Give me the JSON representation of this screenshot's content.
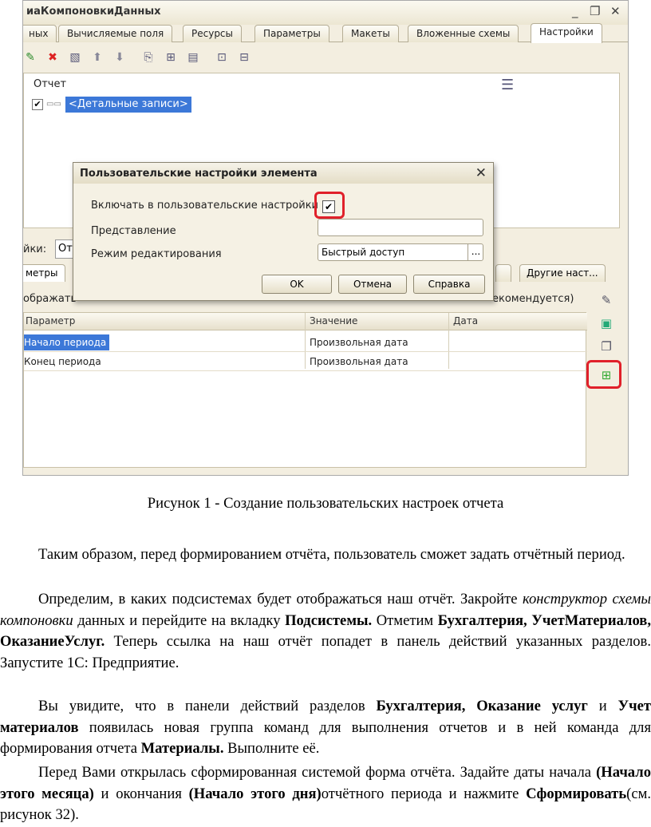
{
  "window": {
    "title": "иаКомпоновкиДанных",
    "min": "_",
    "restore": "❐",
    "close": "✕"
  },
  "tabs": [
    "ных",
    "Вычисляемые поля",
    "Ресурсы",
    "Параметры",
    "Макеты",
    "Вложенные схемы",
    "Настройки"
  ],
  "tree": {
    "root": "Отчет",
    "selected": "<Детальные записи>"
  },
  "lower": {
    "label": "йки:",
    "combo": "От",
    "tab_params": "метры",
    "tab_other": "Другие наст...",
    "display_text": "ображать",
    "recommend_text": "екомендуется)"
  },
  "grid": {
    "headers": [
      "Параметр",
      "Значение",
      "Дата"
    ],
    "rows": [
      {
        "param": "Начало периода",
        "value": "Произвольная дата",
        "date": ""
      },
      {
        "param": "Конец периода",
        "value": "Произвольная дата",
        "date": ""
      }
    ]
  },
  "dialog": {
    "title": "Пользовательские настройки элемента",
    "include_label": "Включать в пользовательские настройки",
    "presentation_label": "Представление",
    "presentation_value": "",
    "mode_label": "Режим редактирования",
    "mode_value": "Быстрый доступ",
    "ellipsis": "...",
    "ok": "OK",
    "cancel": "Отмена",
    "help": "Справка"
  },
  "caption": "Рисунок 1 - Создание пользовательских настроек отчета",
  "text": {
    "p1": "Таким образом, перед формированием отчёта, пользователь сможет задать отчётный период.",
    "p2_a": "Определим, в каких подсистемах будет отображаться наш отчёт. Закройте ",
    "p2_i": "конструктор схемы компоновки",
    "p2_b": " данных и перейдите на вкладку ",
    "p2_bold1": "Подсистемы.",
    "p2_c": " Отметим ",
    "p2_bold2": "Бухгалтерия, УчетМатериалов, ОказаниеУслуг.",
    "p2_d": " Теперь ссылка на наш отчёт попадет в панель действий указанных разделов. Запустите 1С: Предприятие.",
    "p3_a": "Вы увидите, что в панели действий разделов ",
    "p3_bold1": "Бухгалтерия, Оказание услуг",
    "p3_b": " и ",
    "p3_bold2": "Учет материалов",
    "p3_c": " появилась новая группа команд для выполнения отчетов и в ней команда для формирования отчета ",
    "p3_bold3": "Материалы.",
    "p3_d": " Выполните её.",
    "p4_a": "Перед Вами открылась сформированная системой форма отчёта. Задайте даты начала ",
    "p4_bold1": "(Начало этого месяца)",
    "p4_b": " и окончания ",
    "p4_bold2": "(Начало этого дня)",
    "p4_c": "отчётного периода и нажмите ",
    "p4_bold3": "Сформировать",
    "p4_d": "(см. рисунок 32)."
  }
}
